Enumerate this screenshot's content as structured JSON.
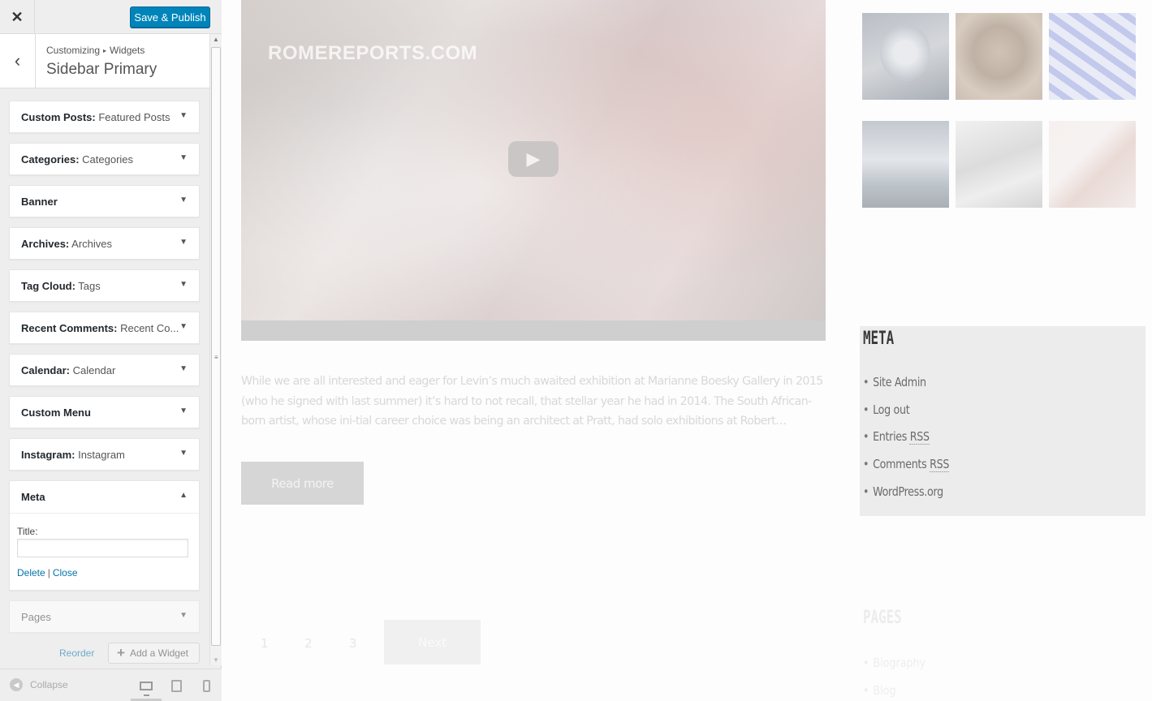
{
  "panel": {
    "close_icon": "close-icon",
    "publish_label": "Save & Publish",
    "breadcrumb": {
      "parent": "Customizing",
      "separator": "▸",
      "current": "Widgets"
    },
    "section_title": "Sidebar Primary",
    "widgets": [
      {
        "name": "Custom Posts:",
        "sub": " Featured Posts",
        "arrow": "▼"
      },
      {
        "name": "Categories:",
        "sub": " Categories",
        "arrow": "▼"
      },
      {
        "name": "Banner",
        "sub": "",
        "arrow": "▼"
      },
      {
        "name": "Archives:",
        "sub": " Archives",
        "arrow": "▼"
      },
      {
        "name": "Tag Cloud:",
        "sub": " Tags",
        "arrow": "▼"
      },
      {
        "name": "Recent Comments:",
        "sub": " Recent Co...",
        "arrow": "▼"
      },
      {
        "name": "Calendar:",
        "sub": " Calendar",
        "arrow": "▼"
      },
      {
        "name": "Custom Menu",
        "sub": "",
        "arrow": "▼"
      },
      {
        "name": "Instagram:",
        "sub": " Instagram",
        "arrow": "▼"
      },
      {
        "name": "Meta",
        "sub": "",
        "arrow": "▲"
      },
      {
        "name": "Pages",
        "sub": "",
        "arrow": "▼"
      }
    ],
    "meta_form": {
      "title_label": "Title:",
      "title_value": "",
      "delete_label": "Delete",
      "separator": "|",
      "close_label": "Close"
    },
    "reorder_label": "Reorder",
    "add_widget_label": "Add a Widget",
    "collapse_label": "Collapse",
    "devices": [
      "desktop",
      "tablet",
      "mobile"
    ],
    "active_device": "desktop",
    "accent_color": "#0085ba"
  },
  "preview": {
    "video": {
      "watermark": "ROMEREPORTS.COM",
      "play_icon": "play-icon"
    },
    "excerpt": "While we are all interested and eager for Levin’s much awaited exhibition at Marianne Boesky Gallery in 2015 (who he signed with last summer) it’s hard to not recall, that stellar year he had in 2014. The South African-born artist, whose ini-tial career choice was being an architect at Pratt, had solo exhibitions at Robert…",
    "read_more_label": "Read more",
    "pagination": {
      "pages": [
        "1",
        "2",
        "3"
      ],
      "next_label": "Next"
    },
    "sidebar": {
      "meta": {
        "heading": "META",
        "items": [
          "Site Admin",
          "Log out",
          "Entries",
          "Comments",
          "WordPress.org"
        ],
        "rss_abbr": "RSS"
      },
      "pages": {
        "heading": "PAGES",
        "items": [
          "Biography",
          "Blog"
        ]
      }
    }
  }
}
